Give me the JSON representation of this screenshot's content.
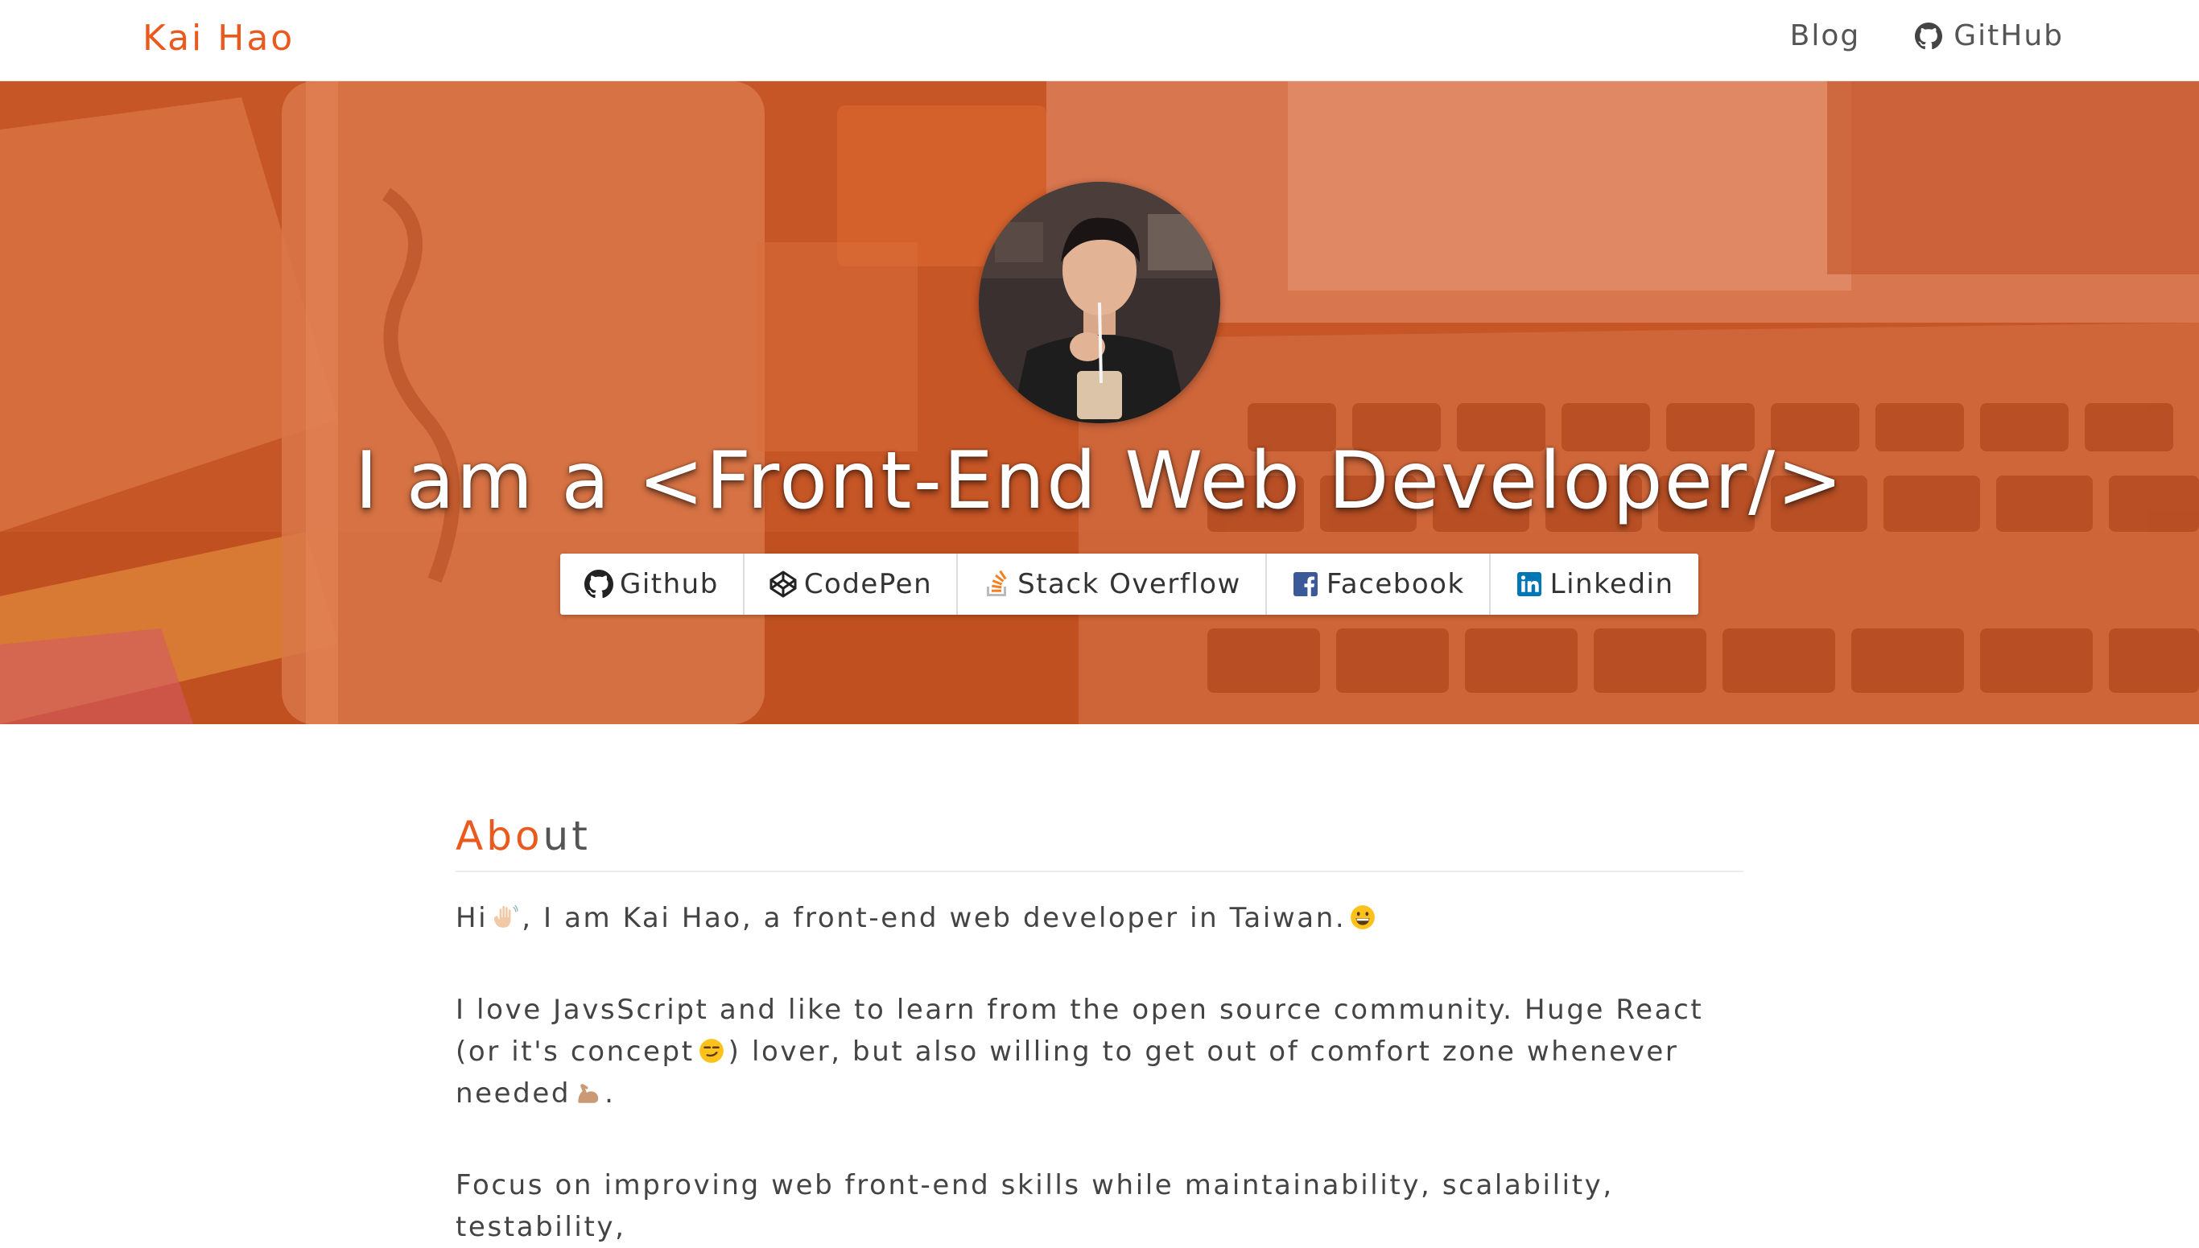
{
  "navbar": {
    "brand": "Kai Hao",
    "links": [
      {
        "label": "Blog",
        "icon": null
      },
      {
        "label": "GitHub",
        "icon": "github-icon"
      }
    ]
  },
  "hero": {
    "tagline": "I am a <Front-End Web Developer/>",
    "overlay_color": "#e25c24",
    "social": [
      {
        "label": "Github",
        "icon": "github-icon"
      },
      {
        "label": "CodePen",
        "icon": "codepen-icon"
      },
      {
        "label": "Stack Overflow",
        "icon": "stackoverflow-icon",
        "icon_color": "#f48024"
      },
      {
        "label": "Facebook",
        "icon": "facebook-icon",
        "icon_color": "#3b5998"
      },
      {
        "label": "Linkedin",
        "icon": "linkedin-icon",
        "icon_color": "#0077b5"
      }
    ]
  },
  "about": {
    "title_accent": "Abo",
    "title_rest": "ut",
    "p1_a": "Hi",
    "p1_b": ", I am Kai Hao, a front-end web developer in Taiwan.",
    "p2_a": "I love JavsScript and like to learn from the open source community. Huge React (or it's concept",
    "p2_b": ") lover, but also willing to get out of comfort zone whenever needed",
    "p2_c": ".",
    "p3": "Focus on improving web front-end skills while maintainability, scalability, testability,"
  },
  "colors": {
    "accent": "#ea5a1f",
    "text": "#444444"
  }
}
